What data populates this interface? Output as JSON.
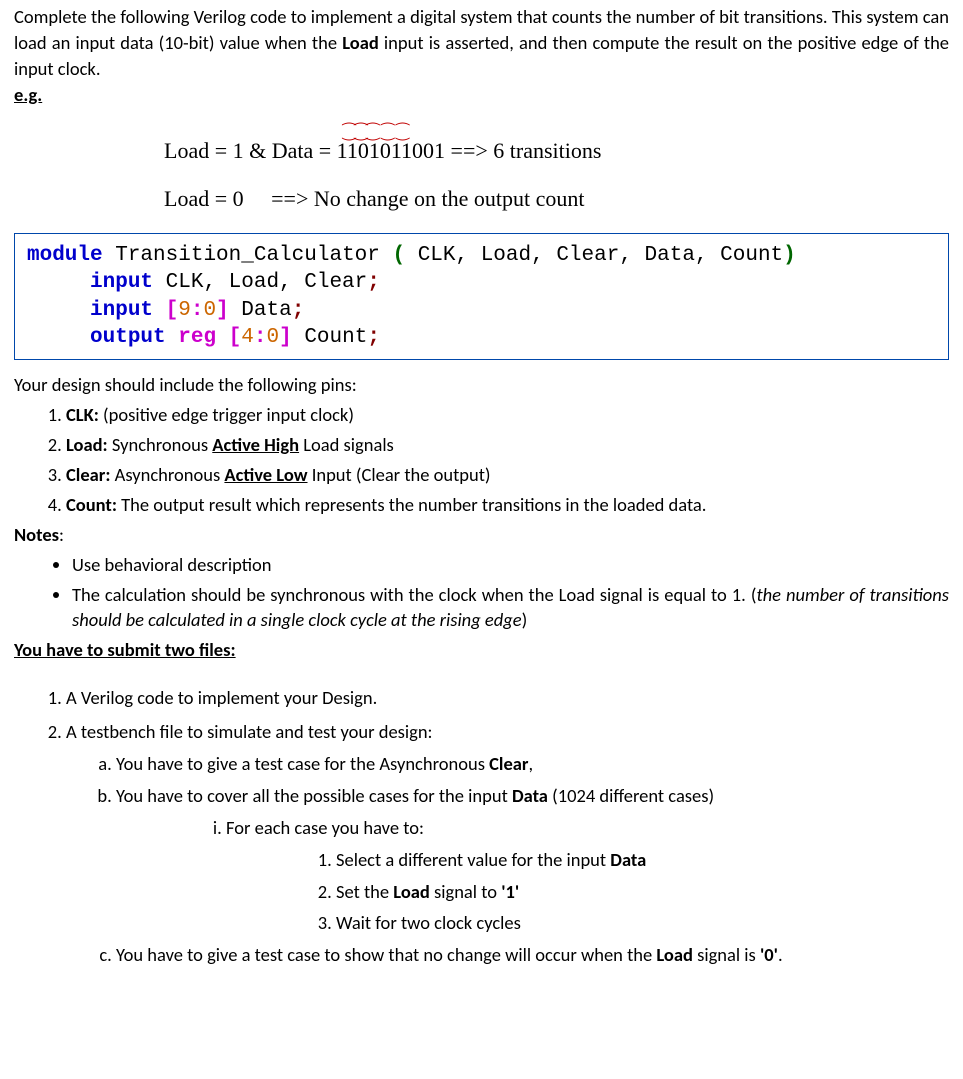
{
  "intro": {
    "p1": "Complete the following Verilog code to implement a digital system that counts the number of bit transitions. This system can load an input data (10-bit) value when the ",
    "p1_bold": "Load",
    "p1_after": " input is asserted, and then compute the result on the positive edge of the input clock.",
    "eg": "e.g."
  },
  "example": {
    "line1_a": "Load = 1 & Data  =  ",
    "line1_data": "1101011001",
    "line1_b": " ==>  6 transitions",
    "line2_a": "Load = 0",
    "line2_b": "==> No change on the output count"
  },
  "code": {
    "l1_kw": "module",
    "l1_id": " Transition_Calculator ",
    "l1_paren_o": "(",
    "l1_args": " CLK, Load, Clear, Data, Count",
    "l1_paren_c": ")",
    "indent": "     ",
    "l2_kw": "input",
    "l2_rest": " CLK, Load, Clear",
    "l3_kw": "input",
    "l3_b1": " [",
    "l3_n1": "9",
    "l3_colon": ":",
    "l3_n2": "0",
    "l3_b2": "]",
    "l3_rest": " Data",
    "l4_kw": "output",
    "l4_reg": " reg",
    "l4_b1": " [",
    "l4_n1": "4",
    "l4_colon": ":",
    "l4_n2": "0",
    "l4_b2": "]",
    "l4_rest": " Count",
    "semi": ";"
  },
  "pins": {
    "heading": "Your design should include the following pins:",
    "items": [
      {
        "label": "CLK:",
        "text": " (positive edge trigger input clock)"
      },
      {
        "label": "Load:",
        "text": "  Synchronous ",
        "ul": "Active High",
        "after": " Load signals"
      },
      {
        "label": "Clear:",
        "text": "  Asynchronous ",
        "ul": "Active Low",
        "after": " Input (Clear the output)"
      },
      {
        "label": "Count:",
        "text": " The output result which represents the number transitions in the loaded data."
      }
    ]
  },
  "notes": {
    "label": "Notes",
    "n1": "Use behavioral description",
    "n2_a": "The calculation should be synchronous with the clock when the Load signal is equal to 1. (",
    "n2_i": "the number of transitions should be calculated in a single clock cycle at the rising edge",
    "n2_b": ")"
  },
  "submit": {
    "heading": "You have to submit two files:",
    "f1": "A Verilog code to implement your Design.",
    "f2": "A testbench file to simulate and test your design:",
    "a_pre": "You have to give a test case for the Asynchronous ",
    "a_b": "Clear",
    "a_post": ",",
    "b_pre": "You have to cover all the possible cases for the input ",
    "b_b": "Data",
    "b_post": " (1024 different cases)",
    "b_i": "For each case you have to:",
    "b_i_1_pre": "Select a different value for the input ",
    "b_i_1_b": "Data",
    "b_i_2_pre": "Set the ",
    "b_i_2_b": "Load",
    "b_i_2_post": " signal to ",
    "b_i_2_v": "'1'",
    "b_i_3": "Wait for two clock cycles",
    "c_pre": "You have to give a test case to show that no change will occur when the ",
    "c_b": "Load",
    "c_post": " signal is ",
    "c_v": "'0'",
    "c_end": "."
  }
}
